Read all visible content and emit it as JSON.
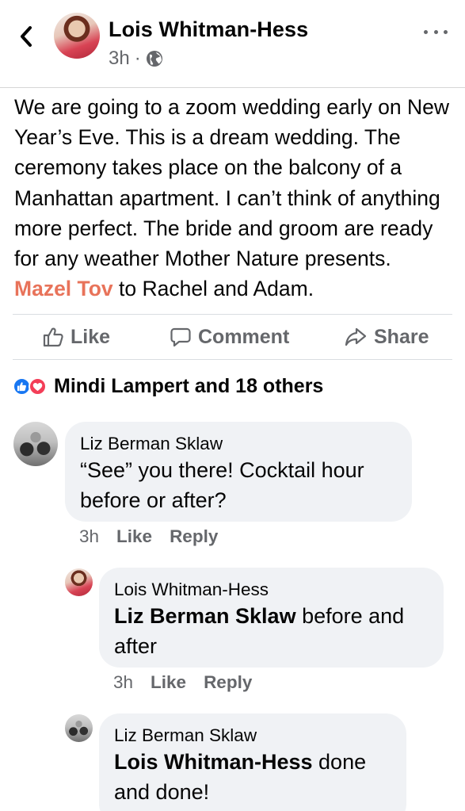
{
  "header": {
    "author": "Lois Whitman-Hess",
    "time": "3h",
    "separator": "·",
    "icons": {
      "back": "chevron-left-icon",
      "privacy": "globe-icon",
      "more": "more-dots-icon"
    }
  },
  "post": {
    "text_before": "We are going to a zoom wedding early on New Year’s Eve. This is a dream wedding. The ceremony takes place on the balcony of a Manhattan apartment. I can’t think of anything more perfect. The bride and groom are ready for any weather Mother Nature presents. ",
    "highlight": "Mazel Tov",
    "text_after": " to Rachel and Adam.",
    "highlight_color": "#e8735a"
  },
  "actions": {
    "like": "Like",
    "comment": "Comment",
    "share": "Share",
    "icons": {
      "like": "thumbs-up-icon",
      "comment": "speech-bubble-icon",
      "share": "share-arrow-icon"
    }
  },
  "reactions": {
    "summary": "Mindi Lampert and 18 others",
    "types": [
      "like",
      "love"
    ],
    "colors": {
      "like": "#1877f2",
      "love": "#f33e58"
    }
  },
  "comments": [
    {
      "author": "Liz Berman Sklaw",
      "tag": "",
      "text": "“See” you there! Cocktail hour before or after?",
      "time": "3h",
      "like": "Like",
      "reply": "Reply",
      "replies": [
        {
          "author": "Lois Whitman-Hess",
          "tag": "Liz Berman Sklaw",
          "text": " before and after",
          "time": "3h",
          "like": "Like",
          "reply": "Reply"
        },
        {
          "author": "Liz Berman Sklaw",
          "tag": "Lois Whitman-Hess",
          "text": " done and done!"
        }
      ]
    }
  ],
  "colors": {
    "meta_gray": "#65676b",
    "bubble_bg": "#f0f2f5",
    "divider": "#dadde1"
  }
}
